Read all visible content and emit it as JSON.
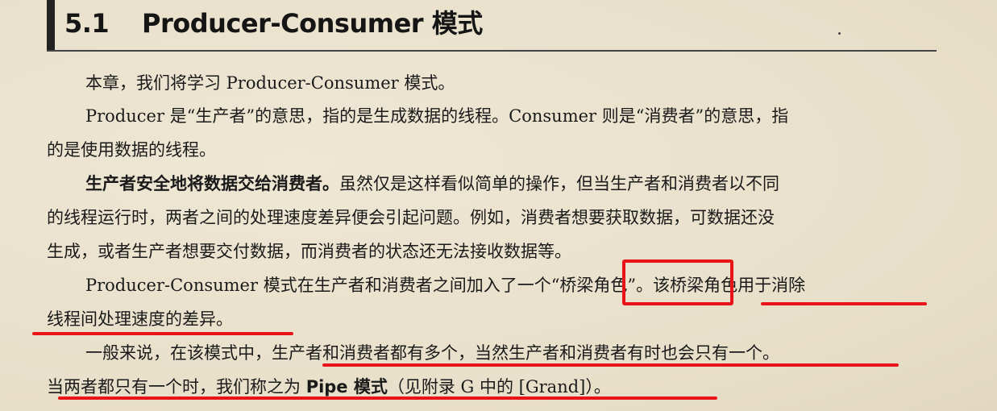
{
  "heading": {
    "number": "5.1",
    "title": "Producer-Consumer 模式"
  },
  "paragraphs": {
    "p1": "本章，我们将学习 Producer-Consumer 模式。",
    "p2_line1": "Producer 是“生产者”的意思，指的是生成数据的线程。Consumer 则是“消费者”的意思，指",
    "p2_line2": "的是使用数据的线程。",
    "p3_bold": "生产者安全地将数据交给消费者。",
    "p3_line1_rest": "虽然仅是这样看似简单的操作，但当生产者和消费者以不同",
    "p3_line2": "的线程运行时，两者之间的处理速度差异便会引起问题。例如，消费者想要获取数据，可数据还没",
    "p3_line3": "生成，或者生产者想要交付数据，而消费者的状态还无法接收数据等。",
    "p4_line1": "Producer-Consumer 模式在生产者和消费者之间加入了一个“桥梁角色”。该桥梁角色用于消除",
    "p4_line2": "线程间处理速度的差异。",
    "p5_line1": "一般来说，在该模式中，生产者和消费者都有多个，当然生产者和消费者有时也会只有一个。",
    "p5_line2_a": "当两者都只有一个时，我们称之为 ",
    "p5_line2_b": "Pipe 模式",
    "p5_line2_c": "（见附录 G 中的 [Grand]）。"
  },
  "annotations": {
    "color": "#e8141a"
  }
}
